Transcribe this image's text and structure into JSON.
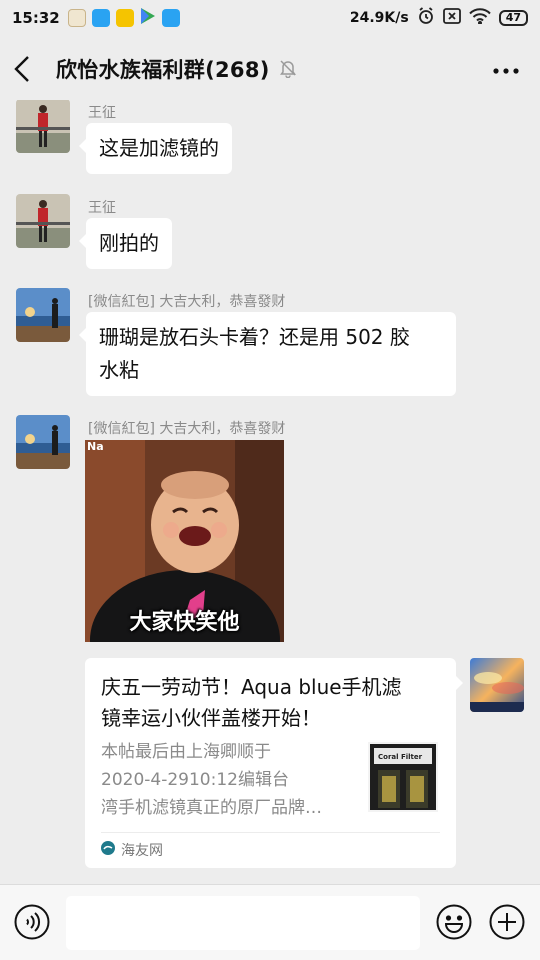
{
  "status_bar": {
    "time": "15:32",
    "net_speed": "24.9K/s",
    "battery": "47"
  },
  "header": {
    "title": "欣怡水族福利群(268)"
  },
  "messages": [
    {
      "sender": "王征",
      "text": "这是加滤镜的"
    },
    {
      "sender": "王征",
      "text": "刚拍的"
    },
    {
      "sender": "[微信紅包] 大吉大利，恭喜發财",
      "text_line1": "珊瑚是放石头卡着？还是用 502 胶",
      "text_line2": "水粘"
    },
    {
      "sender": "[微信紅包] 大吉大利，恭喜發财",
      "sticker_caption": "大家快笑他",
      "sticker_tag": "Na"
    }
  ],
  "card": {
    "title_line1": "庆五一劳动节！Aqua blue手机滤",
    "title_line2": "镜幸运小伙伴盖楼开始！",
    "desc_line1": "本帖最后由上海卿顺于",
    "desc_line2": "2020-4-2910:12编辑台",
    "desc_line3": "湾手机滤镜真正的原厂品牌…",
    "thumb_label": "Coral Filter",
    "source": "海友网"
  }
}
